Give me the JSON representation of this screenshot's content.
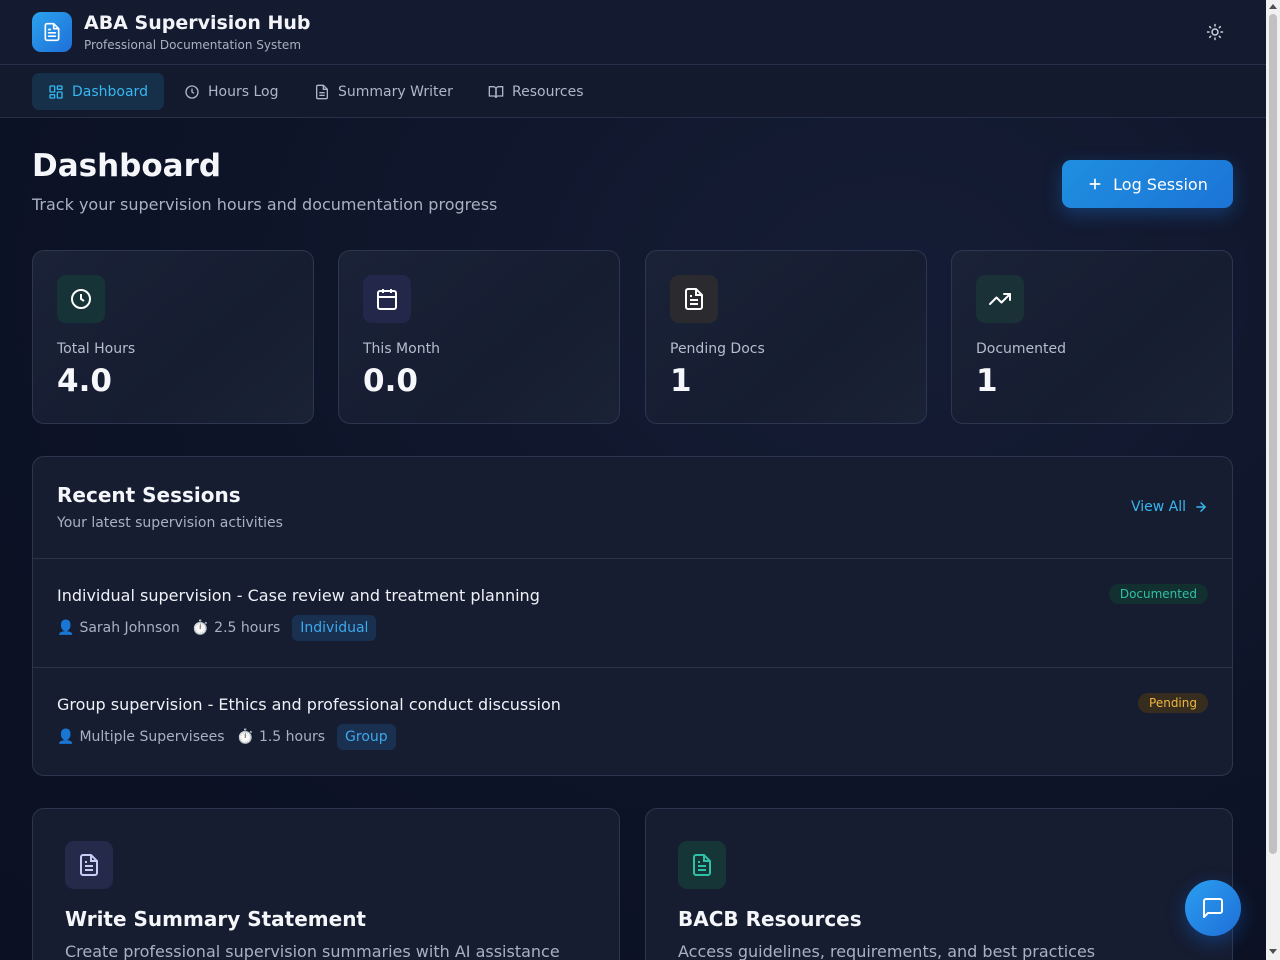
{
  "app": {
    "title": "ABA Supervision Hub",
    "subtitle": "Professional Documentation System"
  },
  "nav": {
    "items": [
      {
        "label": "Dashboard",
        "icon": "grid-icon",
        "active": true
      },
      {
        "label": "Hours Log",
        "icon": "clock-icon"
      },
      {
        "label": "Summary Writer",
        "icon": "document-icon"
      },
      {
        "label": "Resources",
        "icon": "book-icon"
      }
    ]
  },
  "page": {
    "title": "Dashboard",
    "subtitle": "Track your supervision hours and documentation progress",
    "log_button": "Log Session"
  },
  "stats": [
    {
      "label": "Total Hours",
      "value": "4.0",
      "icon": "clock-icon",
      "color": "#2fc0a8"
    },
    {
      "label": "This Month",
      "value": "0.0",
      "icon": "calendar-icon",
      "color": "#c7cdf5"
    },
    {
      "label": "Pending Docs",
      "value": "1",
      "icon": "document-icon",
      "color": "#e6d3b3"
    },
    {
      "label": "Documented",
      "value": "1",
      "icon": "trending-up-icon",
      "color": "#d9f5f0"
    }
  ],
  "recent": {
    "title": "Recent Sessions",
    "subtitle": "Your latest supervision activities",
    "view_all": "View All",
    "sessions": [
      {
        "title": "Individual supervision - Case review and treatment planning",
        "person": "Sarah Johnson",
        "hours": "2.5 hours",
        "type": "Individual",
        "status": "Documented"
      },
      {
        "title": "Group supervision - Ethics and professional conduct discussion",
        "person": "Multiple Supervisees",
        "hours": "1.5 hours",
        "type": "Group",
        "status": "Pending"
      }
    ]
  },
  "cards": [
    {
      "title": "Write Summary Statement",
      "desc": "Create professional supervision summaries with AI assistance",
      "icon": "document-icon"
    },
    {
      "title": "BACB Resources",
      "desc": "Access guidelines, requirements, and best practices",
      "icon": "document-icon"
    }
  ],
  "colors": {
    "accent": "#38b6f0",
    "primary": "#1f8fe0",
    "documented": "#2fc0a8",
    "pending": "#f0b640"
  }
}
